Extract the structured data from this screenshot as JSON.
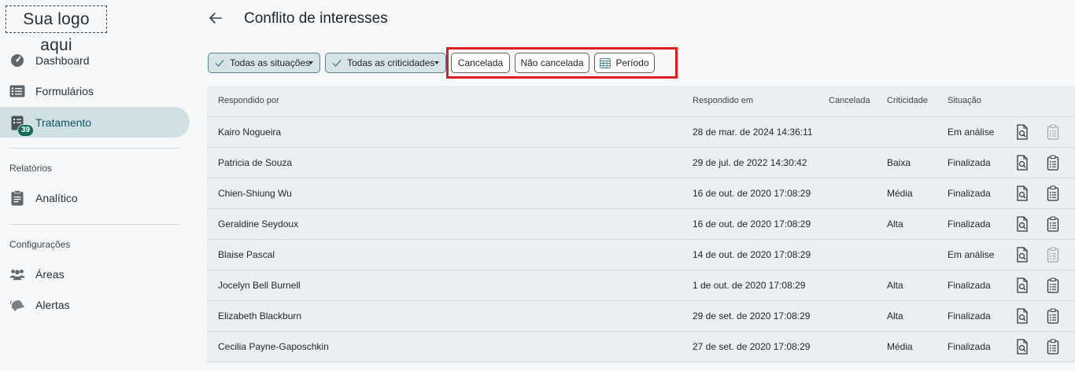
{
  "logo": "Sua logo aqui",
  "nav": {
    "items": [
      {
        "label": "Dashboard",
        "icon": "gauge-icon"
      },
      {
        "label": "Formulários",
        "icon": "list-icon"
      },
      {
        "label": "Tratamento",
        "icon": "checklist-icon",
        "badge": "39",
        "active": true
      }
    ],
    "reports_title": "Relatórios",
    "reports": [
      {
        "label": "Analítico",
        "icon": "clipboard-icon"
      }
    ],
    "settings_title": "Configurações",
    "settings": [
      {
        "label": "Áreas",
        "icon": "people-icon"
      },
      {
        "label": "Alertas",
        "icon": "bell-icon"
      }
    ]
  },
  "header": {
    "title": "Conflito de interesses"
  },
  "filters": {
    "situations": "Todas as situações",
    "criticalities": "Todas as criticidades",
    "cancelled": "Cancelada",
    "not_cancelled": "Não cancelada",
    "period": "Período"
  },
  "table": {
    "headers": {
      "respondent": "Respondido por",
      "answered_at": "Respondido em",
      "cancelled": "Cancelada",
      "criticality": "Criticidade",
      "status": "Situação"
    },
    "rows": [
      {
        "name": "Kairo Nogueira",
        "date": "28 de mar. de 2024 14:36:11",
        "criticality": "",
        "status": "Em análise",
        "treatment_enabled": false
      },
      {
        "name": "Patricia de Souza",
        "date": "29 de jul. de 2022 14:30:42",
        "criticality": "Baixa",
        "status": "Finalizada",
        "treatment_enabled": true
      },
      {
        "name": "Chien-Shiung Wu",
        "date": "16 de out. de 2020 17:08:29",
        "criticality": "Média",
        "status": "Finalizada",
        "treatment_enabled": true
      },
      {
        "name": "Geraldine Seydoux",
        "date": "16 de out. de 2020 17:08:29",
        "criticality": "Alta",
        "status": "Finalizada",
        "treatment_enabled": true
      },
      {
        "name": "Blaise Pascal",
        "date": "14 de out. de 2020 17:08:29",
        "criticality": "",
        "status": "Em análise",
        "treatment_enabled": false
      },
      {
        "name": "Jocelyn Bell Burnell",
        "date": "1 de out. de 2020 17:08:29",
        "criticality": "Alta",
        "status": "Finalizada",
        "treatment_enabled": true
      },
      {
        "name": "Elizabeth Blackburn",
        "date": "29 de set. de 2020 17:08:29",
        "criticality": "Alta",
        "status": "Finalizada",
        "treatment_enabled": true
      },
      {
        "name": "Cecilia Payne-Gaposchkin",
        "date": "27 de set. de 2020 17:08:29",
        "criticality": "Média",
        "status": "Finalizada",
        "treatment_enabled": true
      }
    ]
  },
  "colors": {
    "accent": "#0e5560",
    "active_bg": "#cfe1e4",
    "badge": "#156b58",
    "highlight": "#e01b24"
  }
}
